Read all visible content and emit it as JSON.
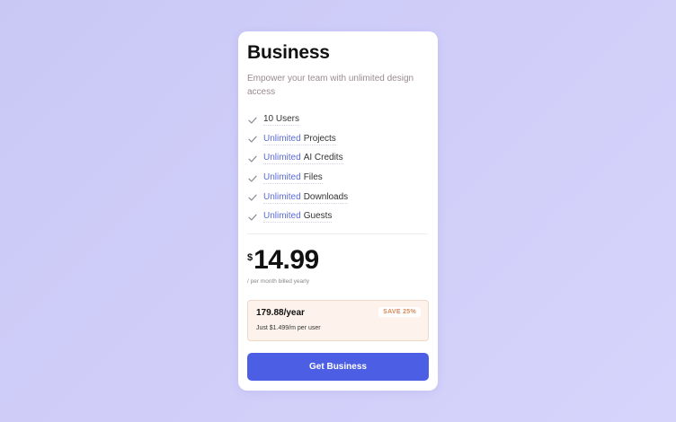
{
  "plan": {
    "title": "Business",
    "subtitle": "Empower your team with unlimited design access"
  },
  "features": [
    {
      "highlight": "",
      "text": "10 Users",
      "icon": "check-icon"
    },
    {
      "highlight": "Unlimited",
      "text": "Projects",
      "icon": "check-icon"
    },
    {
      "highlight": "Unlimited",
      "text": "AI Credits",
      "icon": "check-icon"
    },
    {
      "highlight": "Unlimited",
      "text": "Files",
      "icon": "check-icon"
    },
    {
      "highlight": "Unlimited",
      "text": "Downloads",
      "icon": "check-icon"
    },
    {
      "highlight": "Unlimited",
      "text": "Guests",
      "icon": "check-icon"
    }
  ],
  "price": {
    "currency": "$",
    "amount": "14.99",
    "billing_note": "/ per month billed yearly"
  },
  "offer": {
    "yearly_price": "179.88/year",
    "badge": "SAVE 25%",
    "per_user": "Just $1.499/m per user"
  },
  "cta": {
    "label": "Get Business"
  },
  "colors": {
    "accent": "#4c5ee4",
    "highlight_text": "#5a6bd8",
    "offer_bg": "#fdf3ec",
    "badge_text": "#d78a5b"
  }
}
